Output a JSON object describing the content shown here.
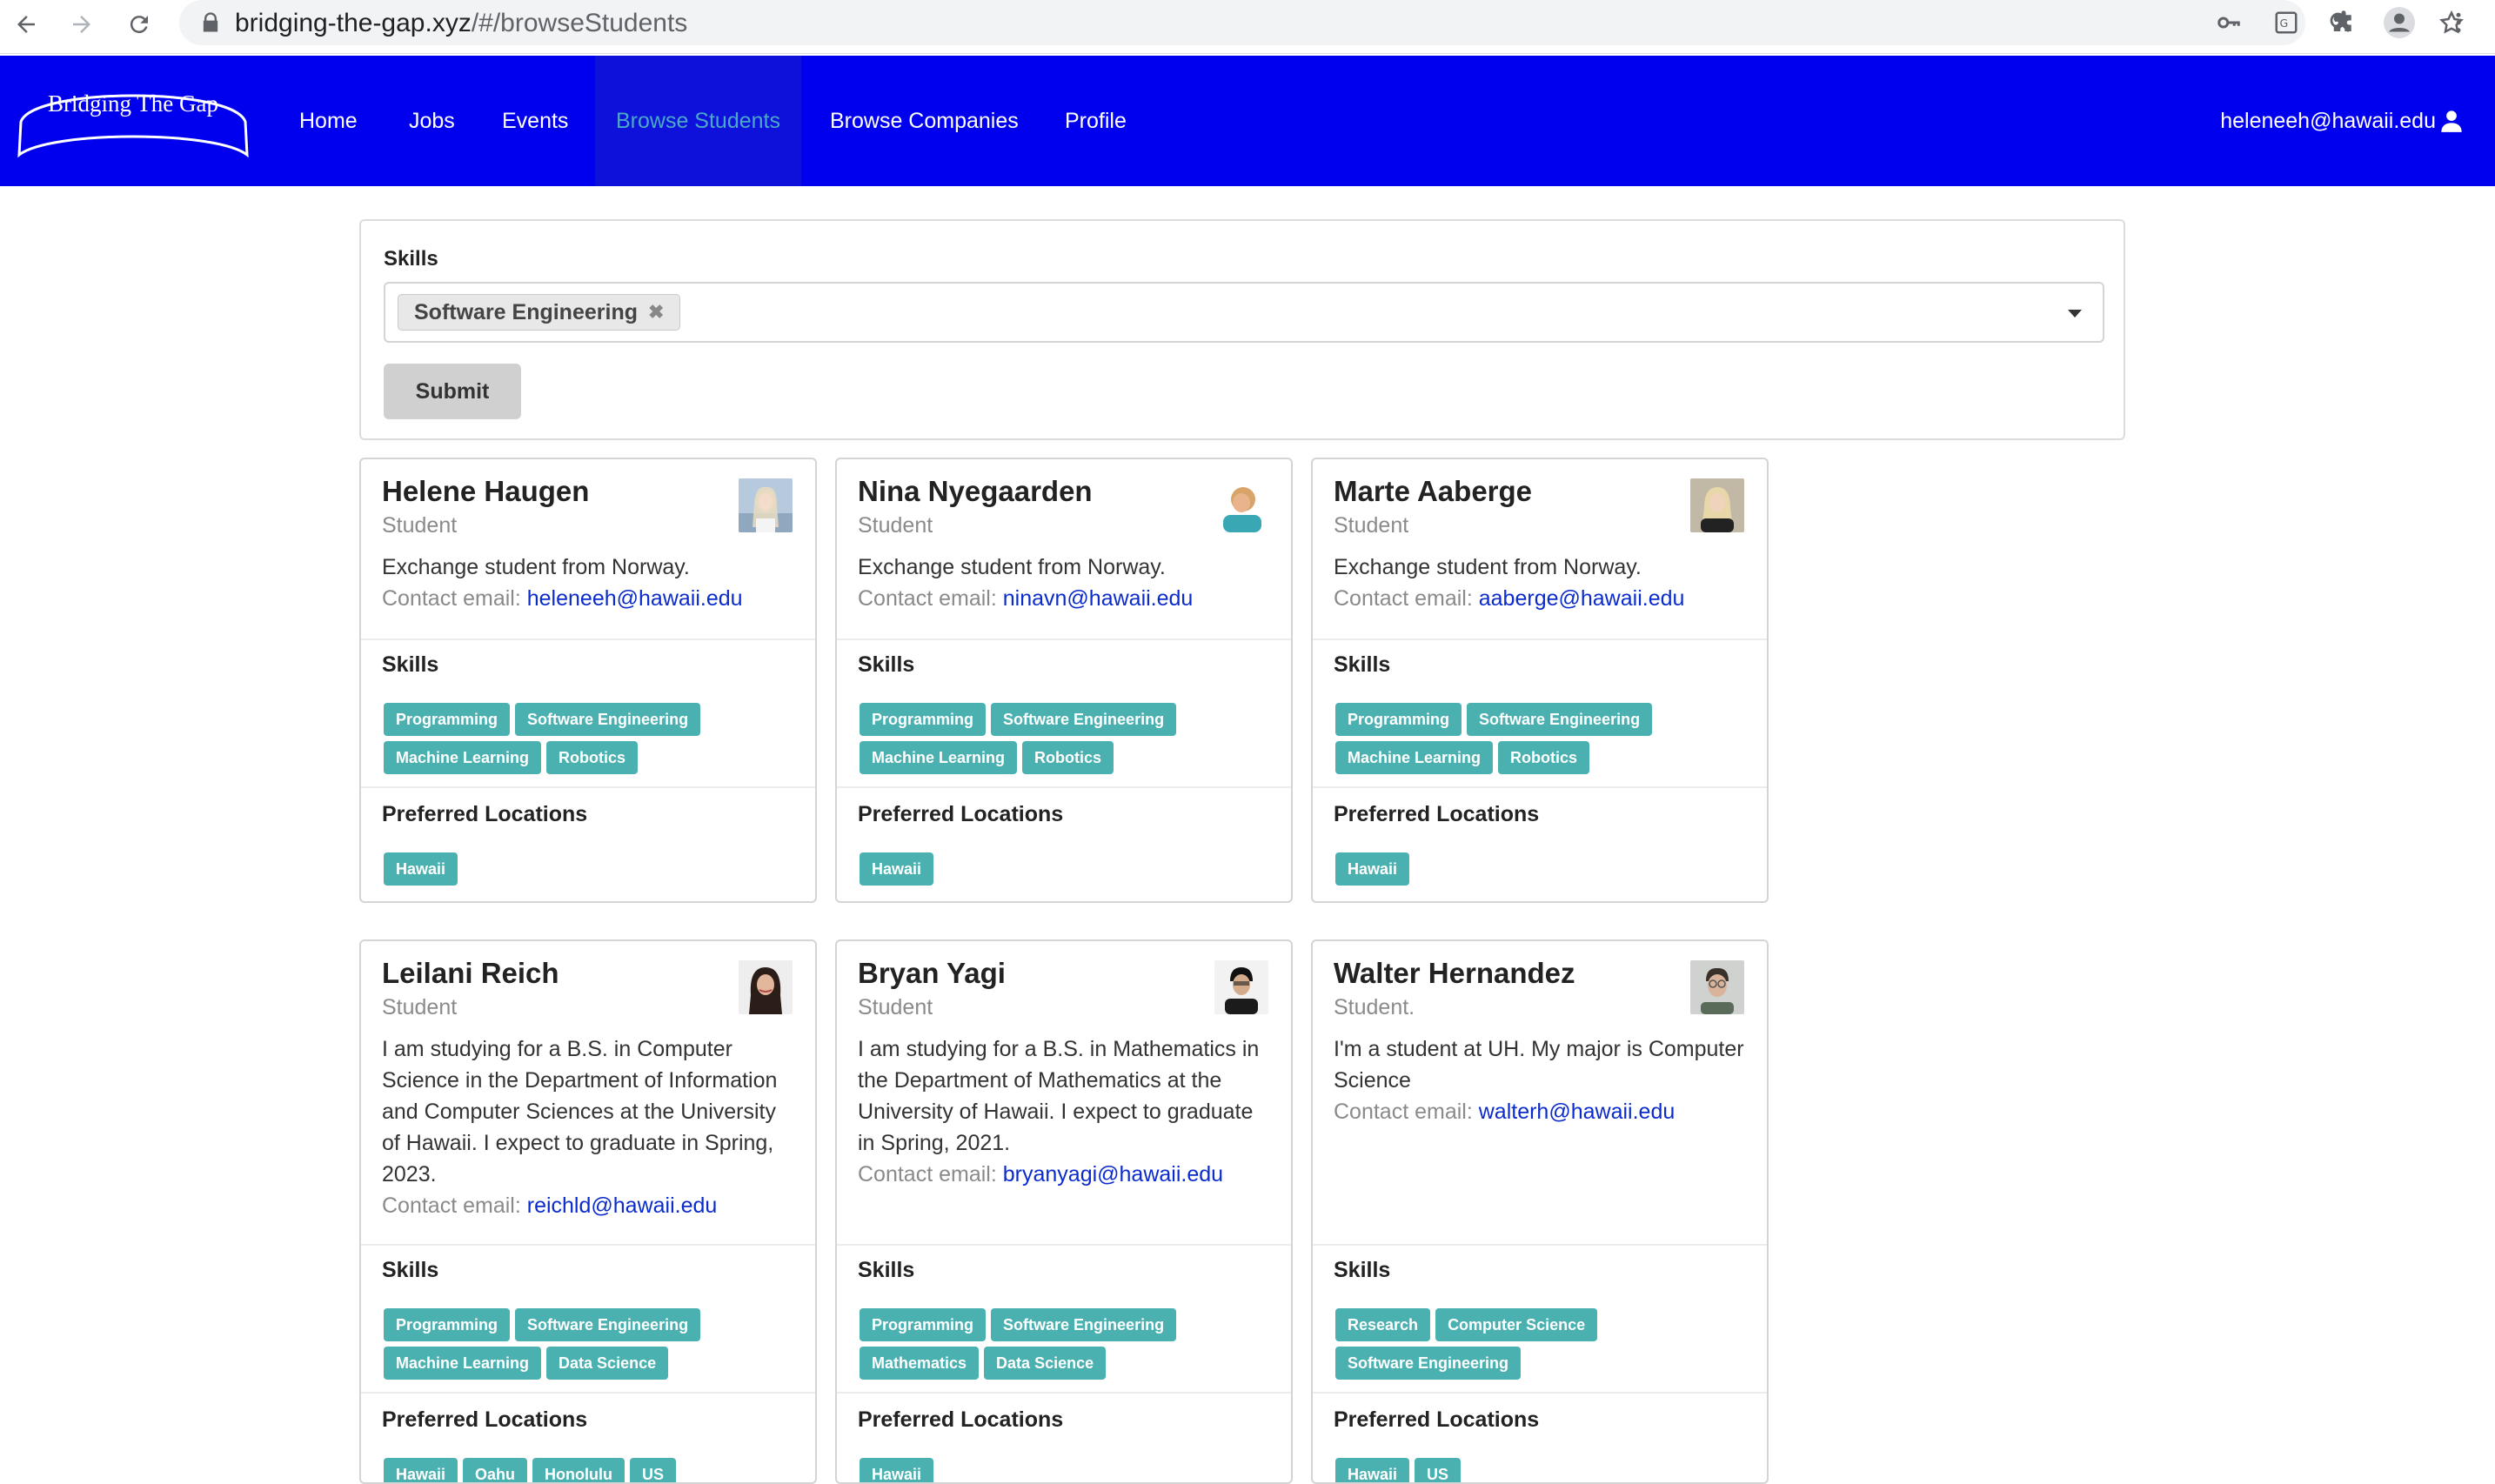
{
  "browser": {
    "url_domain": "bridging-the-gap.xyz",
    "url_path": "/#/browseStudents"
  },
  "navbar": {
    "brand": "Bridging The Gap",
    "items": [
      {
        "label": "Home"
      },
      {
        "label": "Jobs"
      },
      {
        "label": "Events"
      },
      {
        "label": "Browse Students",
        "active": true
      },
      {
        "label": "Browse Companies"
      },
      {
        "label": "Profile"
      }
    ],
    "user_email": "heleneeh@hawaii.edu"
  },
  "filter": {
    "label": "Skills",
    "selected_chip": "Software Engineering",
    "submit_label": "Submit"
  },
  "labels": {
    "contact": "Contact email:",
    "skills": "Skills",
    "locations": "Preferred Locations"
  },
  "students": [
    {
      "name": "Helene Haugen",
      "role": "Student",
      "bio": "Exchange student from Norway.",
      "email": "heleneeh@hawaii.edu",
      "skills": [
        "Programming",
        "Software Engineering",
        "Machine Learning",
        "Robotics"
      ],
      "locations": [
        "Hawaii"
      ]
    },
    {
      "name": "Nina Nyegaarden",
      "role": "Student",
      "bio": "Exchange student from Norway.",
      "email": "ninavn@hawaii.edu",
      "skills": [
        "Programming",
        "Software Engineering",
        "Machine Learning",
        "Robotics"
      ],
      "locations": [
        "Hawaii"
      ]
    },
    {
      "name": "Marte Aaberge",
      "role": "Student",
      "bio": "Exchange student from Norway.",
      "email": "aaberge@hawaii.edu",
      "skills": [
        "Programming",
        "Software Engineering",
        "Machine Learning",
        "Robotics"
      ],
      "locations": [
        "Hawaii"
      ]
    },
    {
      "name": "Leilani Reich",
      "role": "Student",
      "bio": "I am studying for a B.S. in Computer Science in the Department of Information and Computer Sciences at the University of Hawaii. I expect to graduate in Spring, 2023.",
      "email": "reichld@hawaii.edu",
      "skills": [
        "Programming",
        "Software Engineering",
        "Machine Learning",
        "Data Science"
      ],
      "locations": [
        "Hawaii",
        "Oahu",
        "Honolulu",
        "US"
      ]
    },
    {
      "name": "Bryan Yagi",
      "role": "Student",
      "bio": "I am studying for a B.S. in Mathematics in the Department of Mathematics at the University of Hawaii. I expect to graduate in Spring, 2021.",
      "email": "bryanyagi@hawaii.edu",
      "skills": [
        "Programming",
        "Software Engineering",
        "Mathematics",
        "Data Science"
      ],
      "locations": [
        "Hawaii"
      ]
    },
    {
      "name": "Walter Hernandez",
      "role": "Student.",
      "bio": "I'm a student at UH. My major is Computer Science",
      "email": "walterh@hawaii.edu",
      "skills": [
        "Research",
        "Computer Science",
        "Software Engineering"
      ],
      "locations": [
        "Hawaii",
        "US"
      ]
    }
  ]
}
